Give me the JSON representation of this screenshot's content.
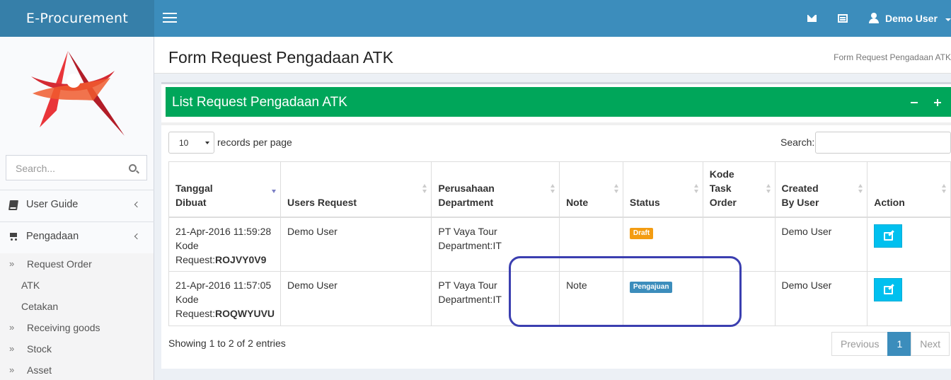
{
  "app": {
    "title": "E-Procurement"
  },
  "header": {
    "user_name": "Demo User",
    "icons": [
      "mail-icon",
      "list-icon",
      "user-icon"
    ]
  },
  "sidebar": {
    "search_placeholder": "Search...",
    "menu": [
      {
        "label": "User Guide",
        "icon": "book-icon"
      },
      {
        "label": "Pengadaan",
        "icon": "cart-icon"
      }
    ],
    "submenu": [
      {
        "label": "Request Order",
        "arrow": "»"
      },
      {
        "label": "ATK",
        "arrow": ""
      },
      {
        "label": "Cetakan",
        "arrow": ""
      },
      {
        "label": "Receiving goods",
        "arrow": "»"
      },
      {
        "label": "Stock",
        "arrow": "»"
      },
      {
        "label": "Asset",
        "arrow": "»"
      }
    ]
  },
  "page": {
    "title": "Form Request Pengadaan ATK",
    "breadcrumb": "Form Request Pengadaan ATK"
  },
  "box": {
    "title": "List Request Pengadaan ATK"
  },
  "table_controls": {
    "page_length": "10",
    "records_label": "records per page",
    "search_label": "Search:"
  },
  "table": {
    "headers": [
      [
        "Tanggal",
        "Dibuat"
      ],
      [
        "Users Request"
      ],
      [
        "Perusahaan",
        "Department"
      ],
      [
        "Note"
      ],
      [
        "Status"
      ],
      [
        "Kode",
        "Task",
        "Order"
      ],
      [
        "Created",
        "By User"
      ],
      [
        "Action"
      ]
    ],
    "rows": [
      {
        "date": "21-Apr-2016 11:59:28",
        "kode_label": "Kode",
        "request_label": "Request:",
        "request_code": "ROJVY0V9",
        "user": "Demo User",
        "company": "PT Vaya Tour",
        "department": "Department:IT",
        "note": "",
        "status": "Draft",
        "status_color": "#f39c12",
        "task_order": "",
        "created_by": "Demo User"
      },
      {
        "date": "21-Apr-2016 11:57:05",
        "kode_label": "Kode",
        "request_label": "Request:",
        "request_code": "ROQWYUVU",
        "user": "Demo User",
        "company": "PT Vaya Tour",
        "department": "Department:IT",
        "note": "Note",
        "status": "Pengajuan",
        "status_color": "#3c8dbc",
        "task_order": "",
        "created_by": "Demo User"
      }
    ]
  },
  "footer": {
    "info": "Showing 1 to 2 of 2 entries",
    "previous": "Previous",
    "page": "1",
    "next": "Next"
  },
  "colors": {
    "header": "#3c8dbc",
    "logo_bg": "#367fa9",
    "box_header": "#00a65a",
    "edit_button": "#00c0ef",
    "annotation": "#3b3fb0"
  }
}
